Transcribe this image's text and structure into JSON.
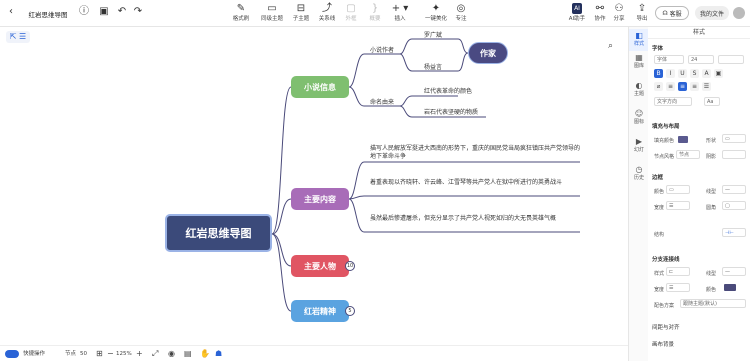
{
  "app": {
    "doc_title": "红岩思维导图",
    "open_button": "客服",
    "my_files": "我的文件"
  },
  "toolbar": {
    "format": "格式刷",
    "same_topic": "同级主题",
    "sub_topic": "子主题",
    "relation": "关系线",
    "outline": "外框",
    "summary": "概要",
    "insert": "插入",
    "beautify": "一键美化",
    "note": "专注",
    "ai_label": "AI助手",
    "share_label": "协作",
    "share2": "分享",
    "export": "导出"
  },
  "map": {
    "root": "红岩思维导图",
    "branches": [
      "小说信息",
      "主要内容",
      "主要人物",
      "红岩精神"
    ],
    "author_label": "小说作者",
    "authors": [
      "罗广斌",
      "杨益言"
    ],
    "author_tag": "作家",
    "name_origin": "命名由来",
    "origins": [
      "红代表革命的颜色",
      "岩石代表坚硬的物质"
    ],
    "content": [
      "描写人民解放军挺进大西南的形势下，重庆的国民党当局疯狂镇压共产党领导的地下革命斗争",
      "着重表现以齐晓轩、许云峰、江雪琴等共产党人在狱中所进行的英勇战斗",
      "虽然最后惨遭屠杀，但充分显示了共产党人视死如归的大无畏英雄气概"
    ],
    "count_people": "10",
    "count_spirit": "5"
  },
  "side_icons": [
    "样式",
    "图库",
    "主题",
    "图标",
    "幻灯",
    "历史"
  ],
  "panel": {
    "title": "样式",
    "font_section": "字体",
    "font_name": "字体",
    "font_size": "24",
    "text_dir": "文字方向",
    "fill_section": "填充与布局",
    "fill_color": "填充颜色",
    "shape": "形状",
    "border_style": "节点风格",
    "border_val": "节点",
    "shadow": "阴影",
    "border_section": "边框",
    "color": "颜色",
    "line": "线型",
    "width": "宽度",
    "corner": "圆角",
    "struct_section": "结构",
    "branch_section": "分支连接线",
    "style": "样式",
    "line2": "线型",
    "width2": "宽度",
    "color2": "颜色",
    "color_scheme": "配色方案",
    "scheme_val": "跟随主题(默认)",
    "spacing": "间距与对齐",
    "bg": "画布背景",
    "fill_hex": "#5a5a8f",
    "line_hex": "#4a4a7a"
  },
  "bottom": {
    "quick": "快捷操作",
    "nodes": "节点",
    "node_count": "50",
    "zoom": "125%"
  },
  "colors": {
    "root": "#3b4a7a",
    "b1": "#7fbf70",
    "b2": "#a86cb8",
    "b3": "#e05563",
    "b4": "#5aa3e0",
    "tag": "#4a4a82"
  }
}
